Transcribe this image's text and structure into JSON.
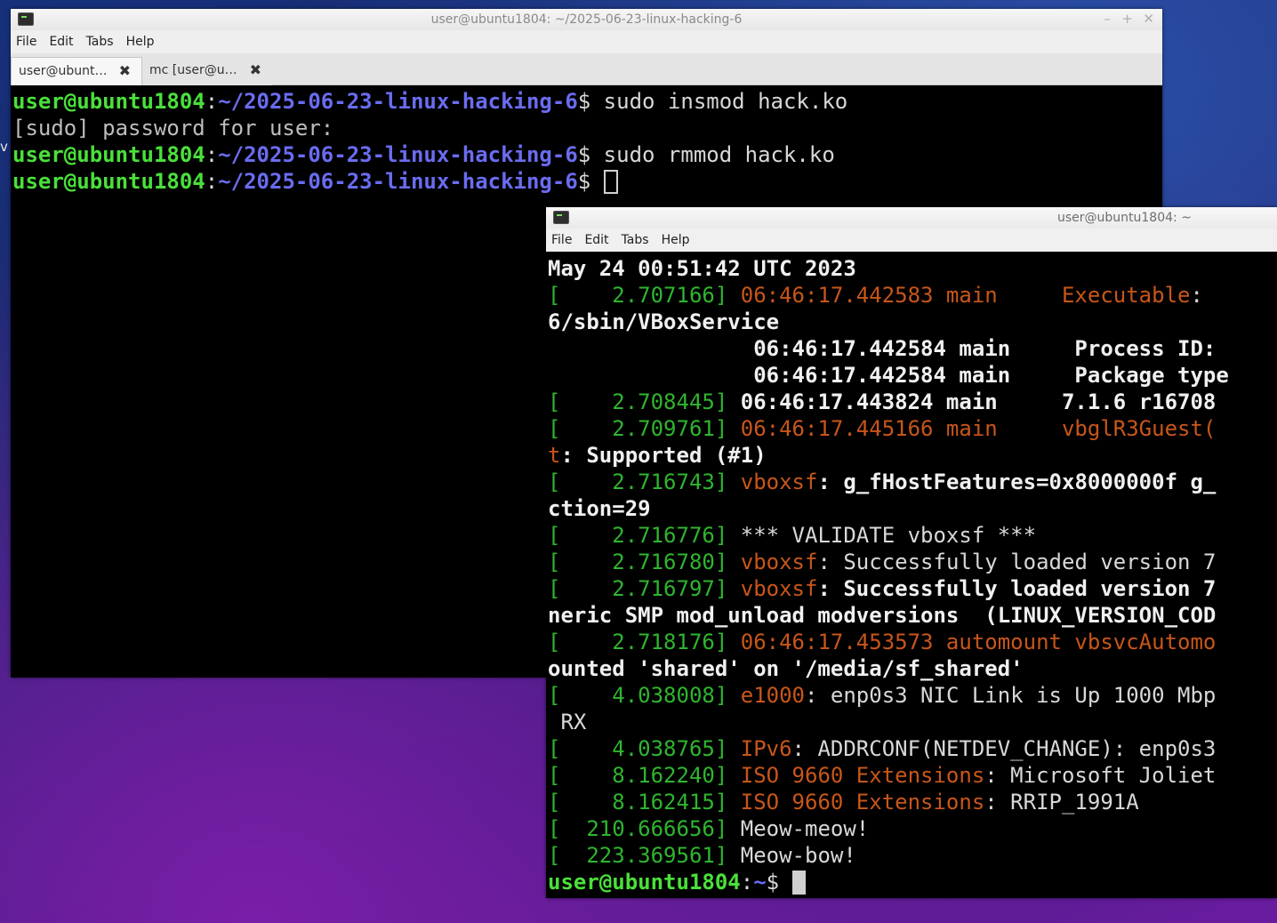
{
  "desktop": {
    "edge_char": "v"
  },
  "window_main": {
    "title": "user@ubuntu1804: ~/2025-06-23-linux-hacking-6",
    "controls": {
      "minimize": "–",
      "maximize": "+",
      "close": "✕"
    },
    "menu": [
      "File",
      "Edit",
      "Tabs",
      "Help"
    ],
    "tabs": [
      {
        "label": "user@ubunt…",
        "close": "✖"
      },
      {
        "label": "mc [user@u…",
        "close": "✖"
      }
    ],
    "terminal": {
      "prompt_user": "user@ubuntu1804",
      "prompt_sep": ":",
      "prompt_path": "~/2025-06-23-linux-hacking-6",
      "prompt_dollar": "$",
      "cmd1": " sudo insmod hack.ko",
      "sudo_line": "[sudo] password for user:",
      "cmd2": " sudo rmmod hack.ko",
      "cmd3": " "
    }
  },
  "window_second": {
    "title": "user@ubuntu1804: ~",
    "menu": [
      "File",
      "Edit",
      "Tabs",
      "Help"
    ],
    "lines": {
      "l01": "May 24 00:51:42 UTC 2023",
      "l02_ts": "[    2.707166]",
      "l02_a": " 06:46:17.442583 main     Executable",
      "l02_b": ":",
      "l03": "6/sbin/VBoxService",
      "l04": "                06:46:17.442584 main     Process ID:",
      "l05": "                06:46:17.442584 main     Package type",
      "l06_ts": "[    2.708445]",
      "l06_a": " 06:46:17.443824 main     7.1.6 r16708",
      "l07_ts": "[    2.709761]",
      "l07_a": " 06:46:17.445166 main     vbglR3Guest(",
      "l08_a": "t",
      "l08_b": ": Supported (#1)",
      "l09_ts": "[    2.716743]",
      "l09_a": " vboxsf",
      "l09_b": ": g_fHostFeatures=0x8000000f g_",
      "l10": "ction=29",
      "l11_ts": "[    2.716776]",
      "l11_a": " *** VALIDATE vboxsf ***",
      "l12_ts": "[    2.716780]",
      "l12_a": " vboxsf",
      "l12_b": ": Successfully loaded version 7",
      "l13_ts": "[    2.716797]",
      "l13_a": " vboxsf",
      "l13_b": ": Successfully loaded version 7",
      "l14": "neric SMP mod_unload modversions  (LINUX_VERSION_COD",
      "l15_ts": "[    2.718176]",
      "l15_a": " 06:46:17.453573 automount vbsvcAutomo",
      "l16": "ounted 'shared' on '/media/sf_shared'",
      "l17_ts": "[    4.038008]",
      "l17_a": " e1000",
      "l17_b": ": enp0s3 NIC Link is Up 1000 Mbp",
      "l18": " RX",
      "l19_ts": "[    4.038765]",
      "l19_a": " IPv6",
      "l19_b": ": ADDRCONF(NETDEV_CHANGE): enp0s3",
      "l20_ts": "[    8.162240]",
      "l20_a": " ISO 9660 Extensions",
      "l20_b": ": Microsoft Joliet",
      "l21_ts": "[    8.162415]",
      "l21_a": " ISO 9660 Extensions",
      "l21_b": ": RRIP_1991A",
      "l22_ts": "[  210.666656]",
      "l22_a": " Meow-meow!",
      "l23_ts": "[  223.369561]",
      "l23_a": " Meow-bow!",
      "prompt_user": "user@ubuntu1804",
      "prompt_sep": ":",
      "prompt_path": "~",
      "prompt_dollar": "$ "
    }
  }
}
